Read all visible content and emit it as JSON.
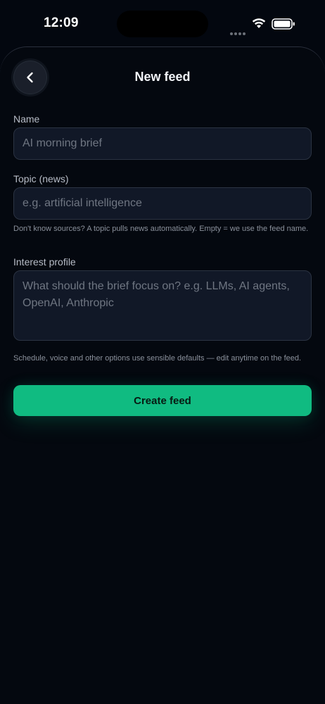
{
  "status_bar": {
    "time": "12:09"
  },
  "header": {
    "title": "New feed",
    "back_icon": "chevron-left-icon"
  },
  "form": {
    "name": {
      "label": "Name",
      "value": "",
      "placeholder": "AI morning brief"
    },
    "topic": {
      "label": "Topic (news)",
      "value": "",
      "placeholder": "e.g. artificial intelligence",
      "help": "Don't know sources? A topic pulls news automatically. Empty = we use the feed name."
    },
    "interest_profile": {
      "label": "Interest profile",
      "value": "",
      "placeholder": "What should the brief focus on? e.g. LLMs, AI agents, OpenAI, Anthropic"
    },
    "defaults_note": "Schedule, voice and other options use sensible defaults — edit anytime on the feed.",
    "submit_label": "Create feed"
  },
  "colors": {
    "background": "#03070f",
    "field_background": "#111827",
    "field_border": "#2b3342",
    "accent": "#10bb81"
  }
}
